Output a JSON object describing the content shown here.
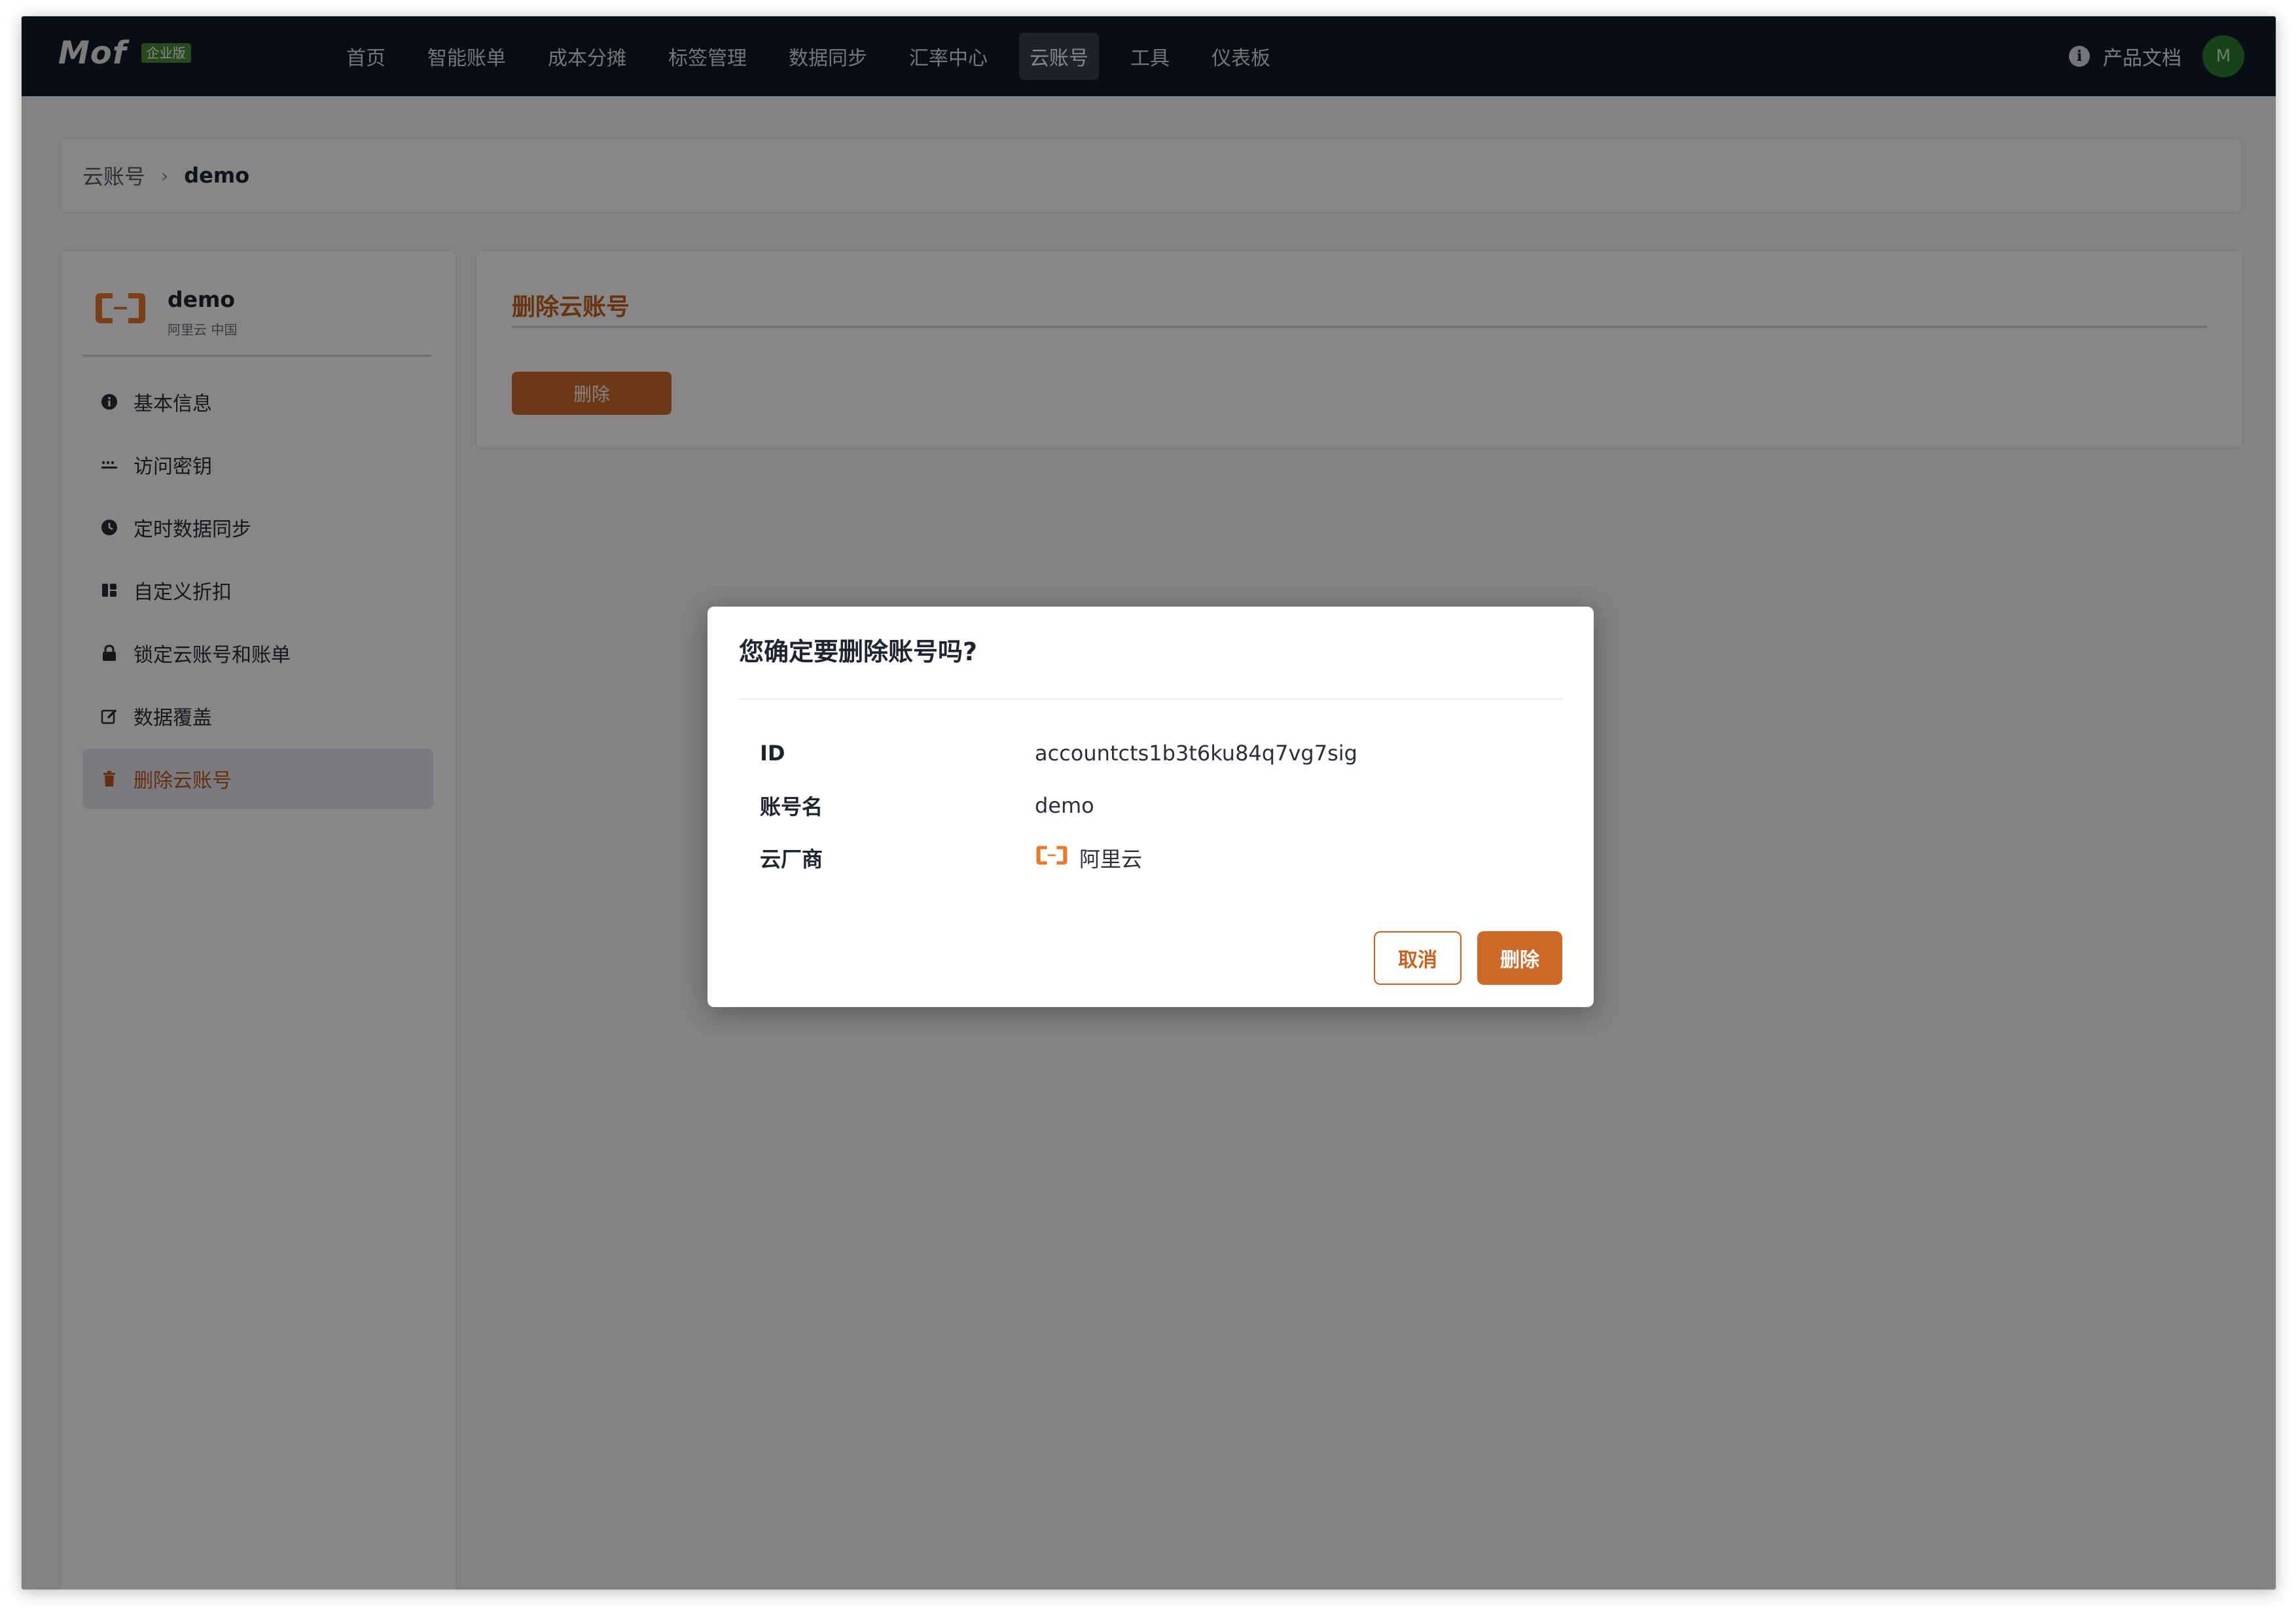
{
  "app": {
    "logo_text": "Mof",
    "edition_badge": "企业版"
  },
  "nav": {
    "items": [
      {
        "label": "首页"
      },
      {
        "label": "智能账单"
      },
      {
        "label": "成本分摊"
      },
      {
        "label": "标签管理"
      },
      {
        "label": "数据同步"
      },
      {
        "label": "汇率中心"
      },
      {
        "label": "云账号",
        "active": true
      },
      {
        "label": "工具"
      },
      {
        "label": "仪表板"
      }
    ],
    "docs_label": "产品文档",
    "avatar_initial": "M",
    "info_icon": "info-icon"
  },
  "breadcrumb": {
    "root": "云账号",
    "separator": "›",
    "current": "demo"
  },
  "account": {
    "name": "demo",
    "subtitle": "阿里云 中国",
    "logo_icon": "aliyun-logo-icon",
    "brand_color": "#e8792b"
  },
  "sidebar": {
    "items": [
      {
        "label": "基本信息",
        "icon": "info-circle-icon"
      },
      {
        "label": "访问密钥",
        "icon": "key-dots-icon"
      },
      {
        "label": "定时数据同步",
        "icon": "clock-icon"
      },
      {
        "label": "自定义折扣",
        "icon": "discount-icon"
      },
      {
        "label": "锁定云账号和账单",
        "icon": "lock-icon"
      },
      {
        "label": "数据覆盖",
        "icon": "edit-icon"
      },
      {
        "label": "删除云账号",
        "icon": "trash-icon",
        "active": true
      }
    ]
  },
  "main": {
    "section_title": "删除云账号",
    "delete_button": "删除"
  },
  "modal": {
    "title": "您确定要删除账号吗?",
    "fields": [
      {
        "key": "ID",
        "value": "accountcts1b3t6ku84q7vg7sig"
      },
      {
        "key": "账号名",
        "value": "demo"
      },
      {
        "key": "云厂商",
        "value": "阿里云"
      }
    ],
    "cancel_label": "取消",
    "confirm_label": "删除"
  },
  "colors": {
    "accent": "#c8601e",
    "nav_bg": "#121a28",
    "overlay": "rgba(0,0,0,0.47)"
  }
}
